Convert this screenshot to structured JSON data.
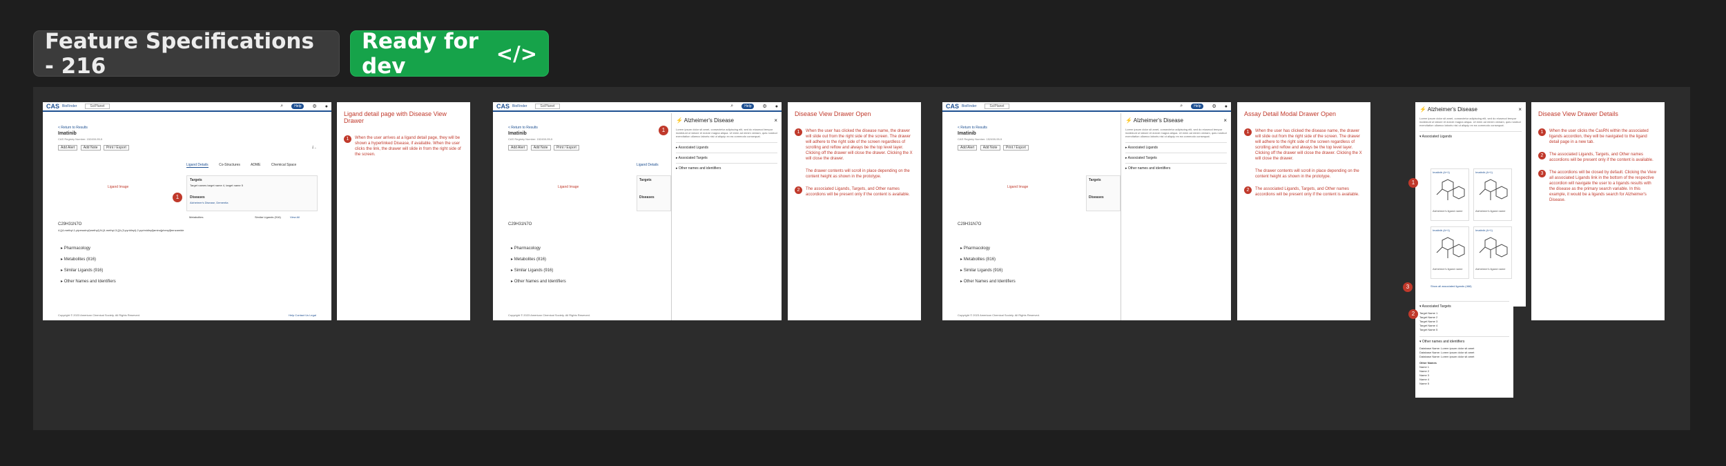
{
  "header": {
    "title": "Feature Specifications - 216",
    "status": "Ready for dev",
    "status_icon": "code-icon"
  },
  "colors": {
    "background": "#1e1e1e",
    "board": "#2c2c2c",
    "ready": "#16a34a",
    "annotation": "#c0392b",
    "brand": "#1d4f91"
  },
  "app": {
    "logo": "CAS",
    "product": "BioFinder",
    "picker": "SciPlanet",
    "help": "Help",
    "breadcrumb": "< Return to Results",
    "compound": "Imatinib",
    "registry": "CAS Registry Number: 152459-95-5",
    "buttons": [
      "Add Alert",
      "Add Note",
      "Print / Export"
    ],
    "structure_label": "Ligand Image",
    "formula": "C29H31N7O",
    "iupac": "4-[(4-methyl-1-piperazinyl)methyl]-N-[4-methyl-3-[[4-(3-pyridinyl)-2-pyrimidinyl]amino]phenyl]benzamide",
    "tabs": [
      "Ligand Details",
      "Co-Structures",
      "ADME",
      "Chemical Space"
    ],
    "targets_label": "Targets",
    "targets_value": "Target names target name 4, target name 5",
    "diseases_label": "Diseases",
    "diseases_value": "Alzheimer's Disease, Dementia",
    "metabolites_label": "Metabolites",
    "similar_label": "Similar Ligands (916)",
    "view_all": "View All",
    "accordions": [
      "Pharmacology",
      "Metabolites (816)",
      "Similar Ligands (916)",
      "Other Names and Identifiers"
    ],
    "footer": "Copyright © 2023 American Chemical Society. All Rights Reserved.",
    "footer_links": "Help  Contact Us  Legal"
  },
  "drawer": {
    "title": "Alzheimer's Disease",
    "sections": [
      "Associated Ligands",
      "Associated Targets",
      "Other names and identifiers"
    ],
    "ligand_caption": "Imatinib (A+1)",
    "ligand_name": "Alzheimer's ligand name",
    "show_all": "Show all associated ligands (468)",
    "targets": [
      "Target Name 1",
      "Target Name 2",
      "Target Name 3",
      "Target Name 4",
      "Target Name 5"
    ],
    "identifiers": [
      "Database Name: Lorem ipsum dolor sit amet",
      "Database Name: Lorem ipsum dolor sit amet",
      "Database Name: Lorem ipsum dolor sit amet"
    ],
    "other_names_label": "Other Names",
    "other_names": [
      "Name 1",
      "Name 2",
      "Name 3",
      "Name 4",
      "Name 5"
    ],
    "lorem": "Lorem ipsum dolor sit amet, consectetur adipiscing elit, sed do eiusmod tempor incididunt ut labore et dolore magna aliqua. Ut enim ad minim veniam, quis nostrud exercitation ullamco laboris nisi ut aliquip ex ea commodo consequat."
  },
  "notes": [
    {
      "title": "Ligand detail page with Disease View Drawer",
      "items": [
        "When the user arrives at a ligand detail page, they will be shown a hyperlinked Disease, if available. When the user clicks the link, the drawer will slide in from the right side of the screen."
      ]
    },
    {
      "title": "Disease View Drawer Open",
      "items": [
        "When the user has clicked the disease name, the drawer will slide out from the right side of the screen. The drawer will adhere to the right side of the screen regardless of scrolling and reflow and always be the top level layer. Clicking off the drawer will close the drawer. Clicking the X will close the drawer.",
        "The drawer contents will scroll in place depending on the content height as shown in the prototype.",
        "The associated Ligands, Targets, and Other names accordions will be present only if the content is available."
      ]
    },
    {
      "title": "Assay Detail Modal Drawer Open",
      "items": [
        "When the user has clicked the disease name, the drawer will slide out from the right side of the screen. The drawer will adhere to the right side of the screen regardless of scrolling and reflow and always be the top level layer. Clicking off the drawer will close the drawer. Clicking the X will close the drawer.",
        "The drawer contents will scroll in place depending on the content height as shown in the prototype.",
        "The associated Ligands, Targets, and Other names accordions will be present only if the content is available."
      ]
    },
    {
      "title": "Disease View Drawer Details",
      "items": [
        "When the user clicks the CasRN within the associated ligands accordion, they will be navigated to the ligand detail page in a new tab.",
        "The associated Ligands, Targets, and Other names accordions will be present only if the content is available.",
        "The accordions will be closed by default. Clicking the View all associated Ligands link in the bottom of the respective accordion will navigate the user to a ligands results with the disease as the primary search variable. In this example, it would be a ligands search for Alzheimer's Disease."
      ]
    }
  ]
}
